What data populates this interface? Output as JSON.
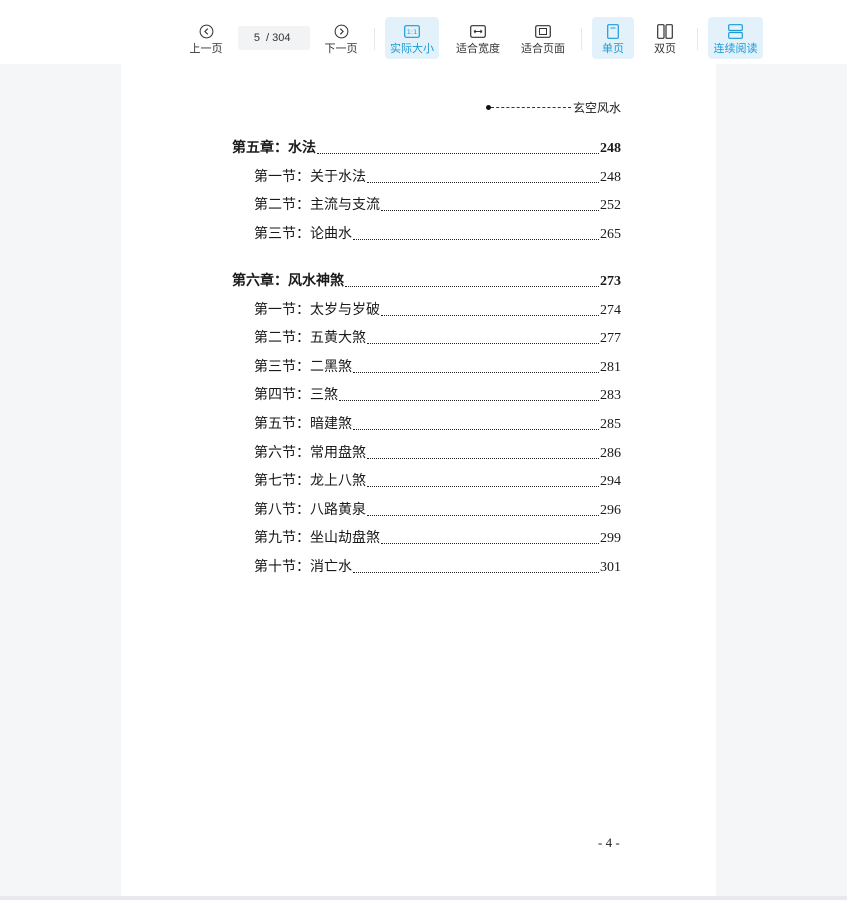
{
  "toolbar": {
    "prev_label": "上一页",
    "current_page": "5",
    "total_pages": "/ 304",
    "next_label": "下一页",
    "actual_size_label": "实际大小",
    "fit_width_label": "适合宽度",
    "fit_page_label": "适合页面",
    "single_page_label": "单页",
    "double_page_label": "双页",
    "continuous_label": "连续阅读",
    "actual_size_icon_text": "1:1"
  },
  "document": {
    "header": "玄空风水",
    "page_number": "- 4 -",
    "toc": [
      {
        "level": "chapter",
        "title": "第五章：水法",
        "page": "248"
      },
      {
        "level": "section",
        "title": "第一节：关于水法",
        "page": "248"
      },
      {
        "level": "section",
        "title": "第二节：主流与支流",
        "page": "252"
      },
      {
        "level": "section",
        "title": "第三节：论曲水",
        "page": "265"
      },
      {
        "level": "chapter",
        "title": "第六章：风水神煞",
        "page": "273"
      },
      {
        "level": "section",
        "title": "第一节：太岁与岁破",
        "page": "274"
      },
      {
        "level": "section",
        "title": "第二节：五黄大煞",
        "page": "277"
      },
      {
        "level": "section",
        "title": "第三节：二黑煞",
        "page": "281"
      },
      {
        "level": "section",
        "title": "第四节：三煞",
        "page": "283"
      },
      {
        "level": "section",
        "title": "第五节：暗建煞",
        "page": "285"
      },
      {
        "level": "section",
        "title": "第六节：常用盘煞",
        "page": "286"
      },
      {
        "level": "section",
        "title": "第七节：龙上八煞",
        "page": "294"
      },
      {
        "level": "section",
        "title": "第八节：八路黄泉",
        "page": "296"
      },
      {
        "level": "section",
        "title": "第九节：坐山劫盘煞",
        "page": "299"
      },
      {
        "level": "section",
        "title": "第十节：消亡水",
        "page": "301"
      }
    ]
  },
  "colors": {
    "accent": "#1a9bd7",
    "active_bg": "#e3f1fb",
    "viewer_bg": "#f5f6f8"
  }
}
